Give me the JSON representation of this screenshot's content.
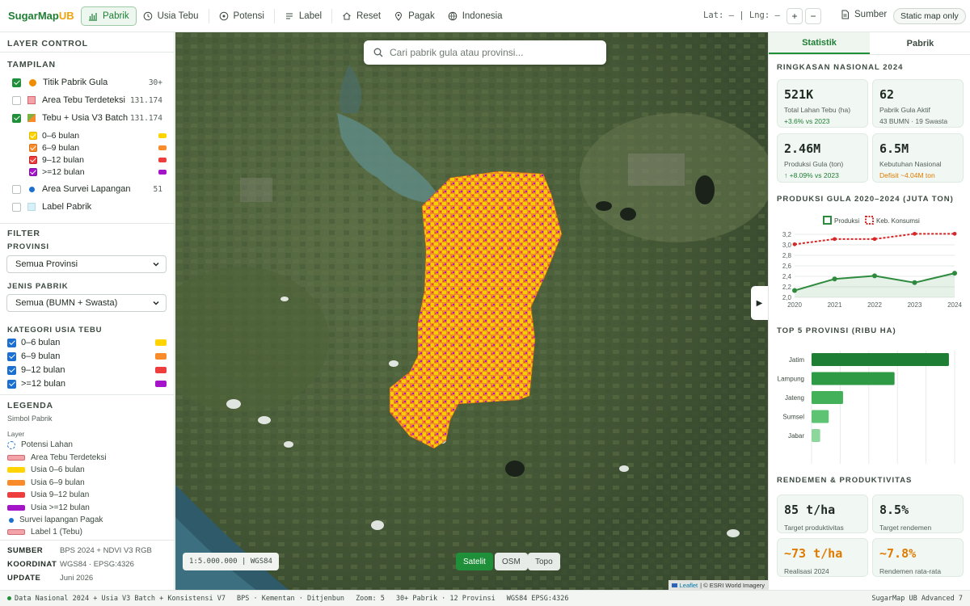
{
  "brand": {
    "name": "SugarMap",
    "suffix": "UB"
  },
  "nav": [
    {
      "label": "Pabrik",
      "icon": "bar-chart-icon",
      "active": true
    },
    {
      "label": "Usia Tebu",
      "icon": "clock-icon"
    },
    {
      "label": "Potensi",
      "icon": "target-icon"
    },
    {
      "label": "Label",
      "icon": "lines-icon"
    },
    {
      "label": "Reset",
      "icon": "home-icon"
    },
    {
      "label": "Pagak",
      "icon": "pin-icon"
    },
    {
      "label": "Indonesia",
      "icon": "globe-icon"
    }
  ],
  "coords_label": "Lat: – | Lng: –",
  "zoom": {
    "in": "+",
    "out": "−"
  },
  "source_label": "Sumber",
  "static_label": "Static map only",
  "left": {
    "layer_control": "LAYER CONTROL",
    "tampilan": "TAMPILAN",
    "layers": [
      {
        "label": "Titik Pabrik Gula",
        "count": "30+",
        "checked": true,
        "marker": "#f08c00",
        "marker_shape": "dot"
      },
      {
        "label": "Area Tebu Terdeteksi",
        "count": "131.174",
        "checked": false,
        "marker": "#f4a3a8",
        "marker_shape": "square"
      },
      {
        "label": "Tebu + Usia V3 Batch",
        "count": "131.174",
        "checked": true,
        "marker": "#7cb342",
        "marker_shape": "square"
      }
    ],
    "sublayers": [
      {
        "label": "0–6 bulan",
        "color": "#ffd400",
        "check": "#ffd400"
      },
      {
        "label": "6–9 bulan",
        "color": "#f98b2a",
        "check": "#f98b2a"
      },
      {
        "label": "9–12 bulan",
        "color": "#ee3d3d",
        "check": "#ee3d3d"
      },
      {
        "label": ">=12 bulan",
        "color": "#a414c9",
        "check": "#a414c9"
      }
    ],
    "extra_layers": [
      {
        "label": "Area Survei Lapangan",
        "count": "51",
        "marker": "#1a6fd1"
      },
      {
        "label": "Label Pabrik",
        "count": "",
        "marker": "#d6f0f7"
      }
    ],
    "filter": "FILTER",
    "provinsi_label": "PROVINSI",
    "provinsi_value": "Semua Provinsi",
    "jenis_label": "JENIS PABRIK",
    "jenis_value": "Semua (BUMN + Swasta)",
    "kategori_label": "KATEGORI USIA TEBU",
    "kategori": [
      {
        "label": "0–6 bulan",
        "color": "#ffd400"
      },
      {
        "label": "6–9 bulan",
        "color": "#f98b2a"
      },
      {
        "label": "9–12 bulan",
        "color": "#ee3d3d"
      },
      {
        "label": ">=12 bulan",
        "color": "#a414c9"
      }
    ],
    "legenda": "LEGENDA",
    "simbol_pabrik": "Simbol Pabrik",
    "layer_label": "Layer",
    "legend_items": [
      {
        "label": "Potensi Lahan",
        "color": "#1a6fd1",
        "kind": "ring"
      },
      {
        "label": "Area Tebu Terdeteksi",
        "color": "#f4a3a8",
        "kind": "bar"
      },
      {
        "label": "Usia 0–6 bulan",
        "color": "#ffd400",
        "kind": "bar"
      },
      {
        "label": "Usia 6–9 bulan",
        "color": "#f98b2a",
        "kind": "bar"
      },
      {
        "label": "Usia 9–12 bulan",
        "color": "#ee3d3d",
        "kind": "bar"
      },
      {
        "label": "Usia >=12 bulan",
        "color": "#a414c9",
        "kind": "bar"
      },
      {
        "label": "Survei lapangan Pagak",
        "color": "#1a6fd1",
        "kind": "dot"
      },
      {
        "label": "Label 1 (Tebu)",
        "color": "#f4a3a8",
        "kind": "bar"
      }
    ],
    "info": [
      {
        "k": "SUMBER",
        "v": "BPS 2024 + NDVI V3 RGB"
      },
      {
        "k": "KOORDINAT",
        "v": "WGS84 · EPSG:4326"
      },
      {
        "k": "UPDATE",
        "v": "Juni 2026"
      }
    ]
  },
  "map": {
    "search_placeholder": "Cari pabrik gula atau provinsi...",
    "scale": "1:5.000.000 | WGS84",
    "basemaps": [
      {
        "label": "Satelit",
        "active": true
      },
      {
        "label": "OSM",
        "active": false
      },
      {
        "label": "Topo",
        "active": false
      }
    ],
    "attrib_leaflet": "Leaflet",
    "attrib_rest": "| © ESRI World Imagery"
  },
  "right": {
    "tabs": [
      {
        "label": "Statistik",
        "active": true
      },
      {
        "label": "Pabrik",
        "active": false
      }
    ],
    "ringkasan_title": "RINGKASAN NASIONAL 2024",
    "cards": [
      {
        "val": "521K",
        "lbl": "Total Lahan Tebu (ha)",
        "delta": "+3.6% vs 2023",
        "tone": "up"
      },
      {
        "val": "62",
        "lbl": "Pabrik Gula Aktif",
        "delta": "43 BUMN · 19 Swasta",
        "tone": "neutral"
      },
      {
        "val": "2.46M",
        "lbl": "Produksi Gula (ton)",
        "delta": "↑ +8.09% vs 2023",
        "tone": "up"
      },
      {
        "val": "6.5M",
        "lbl": "Kebutuhan Nasional",
        "delta": "Defisit ~4.04M ton",
        "tone": "warn"
      }
    ],
    "produksi_title": "PRODUKSI GULA 2020–2024 (JUTA TON)",
    "top5_title": "TOP 5 PROVINSI (RIBU HA)",
    "rendemen_title": "RENDEMEN & PRODUKTIVITAS",
    "rendemen_cards": [
      {
        "val": "85 t/ha",
        "lbl": "Target produktivitas",
        "tone": "neutral"
      },
      {
        "val": "8.5%",
        "lbl": "Target rendemen",
        "tone": "neutral"
      },
      {
        "val": "~73 t/ha",
        "lbl": "Realisasi 2024",
        "tone": "orange"
      },
      {
        "val": "~7.8%",
        "lbl": "Rendemen rata-rata",
        "tone": "orange"
      }
    ]
  },
  "chart_data": [
    {
      "type": "line",
      "title": "PRODUKSI GULA 2020–2024 (JUTA TON)",
      "x": [
        2020,
        2021,
        2022,
        2023,
        2024
      ],
      "series": [
        {
          "name": "Produksi",
          "values": [
            2.13,
            2.35,
            2.41,
            2.28,
            2.46
          ],
          "color": "#2e8b3e",
          "style": "solid"
        },
        {
          "name": "Keb. Konsumsi",
          "values": [
            3.01,
            3.11,
            3.11,
            3.21,
            3.21
          ],
          "color": "#d62828",
          "style": "dashed"
        }
      ],
      "ylim": [
        2.0,
        3.2
      ],
      "yticks": [
        "2,0",
        "2,2",
        "2,4",
        "2,6",
        "2,8",
        "3,0",
        "3,2"
      ],
      "legend": "top"
    },
    {
      "type": "bar",
      "orientation": "horizontal",
      "title": "TOP 5 PROVINSI (RIBU HA)",
      "categories": [
        "Jatim",
        "Lampung",
        "Jateng",
        "Sumsel",
        "Jabar"
      ],
      "values": [
        240,
        145,
        55,
        30,
        15
      ],
      "colors": [
        "#1e7e34",
        "#2e9a45",
        "#43b05a",
        "#5ec372",
        "#8ed79c"
      ],
      "xlim": [
        0,
        250
      ],
      "xticks": [
        0,
        50,
        100,
        150,
        200,
        250
      ]
    }
  ],
  "footer": {
    "segments": [
      "Data Nasional 2024 + Usia V3 Batch + Konsistensi V7",
      "BPS · Kementan · Ditjenbun",
      "Zoom: 5",
      "30+ Pabrik · 12 Provinsi",
      "WGS84 EPSG:4326"
    ],
    "version": "SugarMap UB Advanced 7"
  }
}
